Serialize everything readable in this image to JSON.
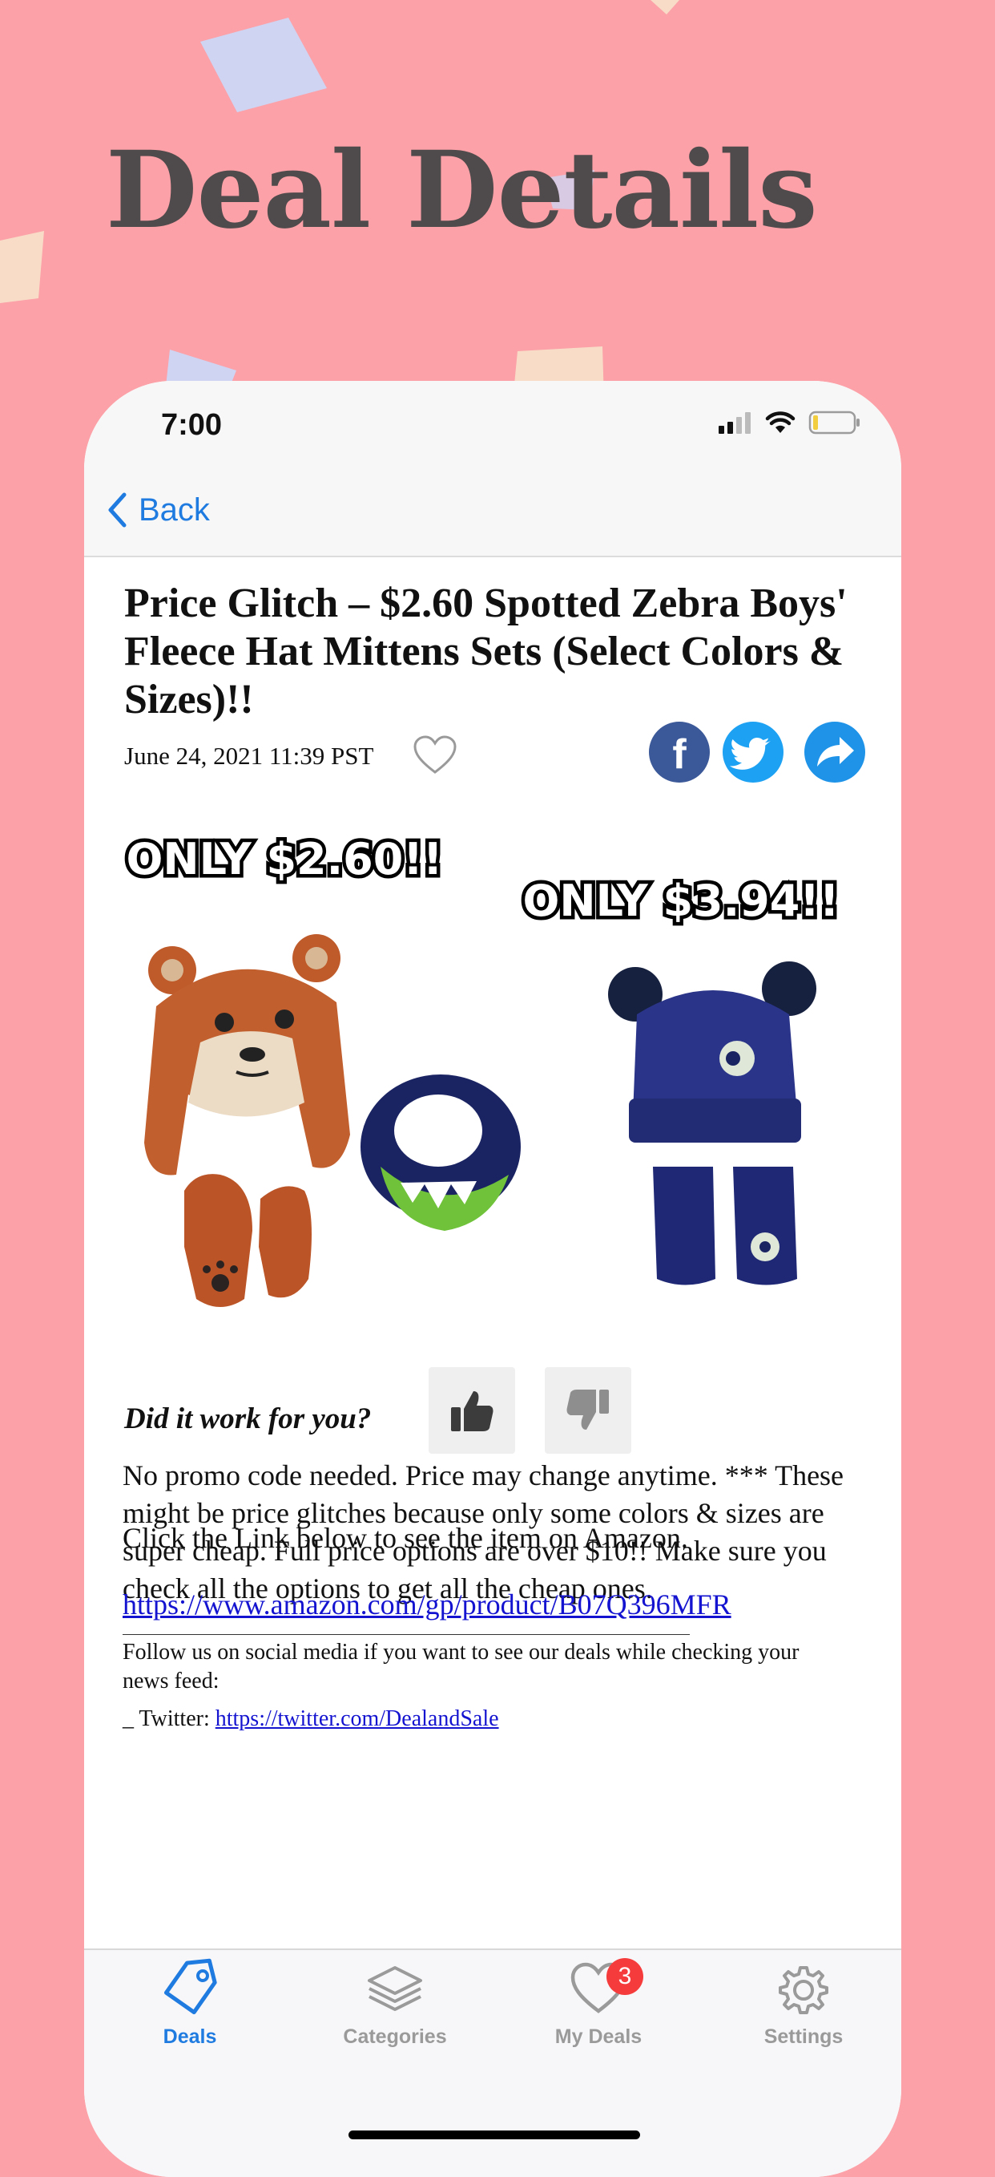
{
  "hero": {
    "title": "Deal Details"
  },
  "status_bar": {
    "time": "7:00"
  },
  "nav": {
    "back_label": "Back"
  },
  "post": {
    "title": "Price Glitch – $2.60 Spotted Zebra Boys' Fleece Hat Mittens Sets (Select Colors & Sizes)!!",
    "date": "June 24, 2021 11:39 PST",
    "image_label_left": "ONLY $2.60!!",
    "image_label_right": "ONLY $3.94!!",
    "feedback_question": "Did it work for you?",
    "paragraph1": "No promo code needed. Price may change anytime. *** These might be price glitches because only some colors & sizes are super cheap. Full price options are over $10!! Make sure you check all the options to get all the cheap ones.",
    "paragraph2": "Click the Link below to see the item on Amazon.",
    "amazon_link": "https://www.amazon.com/gp/product/B07Q396MFR",
    "social_intro": "Follow us on social media if you want to see our deals while checking your news feed:",
    "twitter_prefix": "_ Twitter: ",
    "twitter_link": "https://twitter.com/DealandSale"
  },
  "share_icons": [
    "facebook-icon",
    "twitter-icon",
    "share-arrow-icon"
  ],
  "tabs": [
    {
      "label": "Deals",
      "icon": "tag-icon",
      "active": true
    },
    {
      "label": "Categories",
      "icon": "layers-icon",
      "active": false
    },
    {
      "label": "My Deals",
      "icon": "heart-icon",
      "active": false,
      "badge": "3"
    },
    {
      "label": "Settings",
      "icon": "gear-icon",
      "active": false
    }
  ],
  "colors": {
    "background": "#fca1a7",
    "accent": "#1f7be0",
    "facebook": "#3b5998",
    "twitter": "#1da1f2",
    "badge": "#f53b3b",
    "tab_inactive": "#9a9a9a"
  }
}
